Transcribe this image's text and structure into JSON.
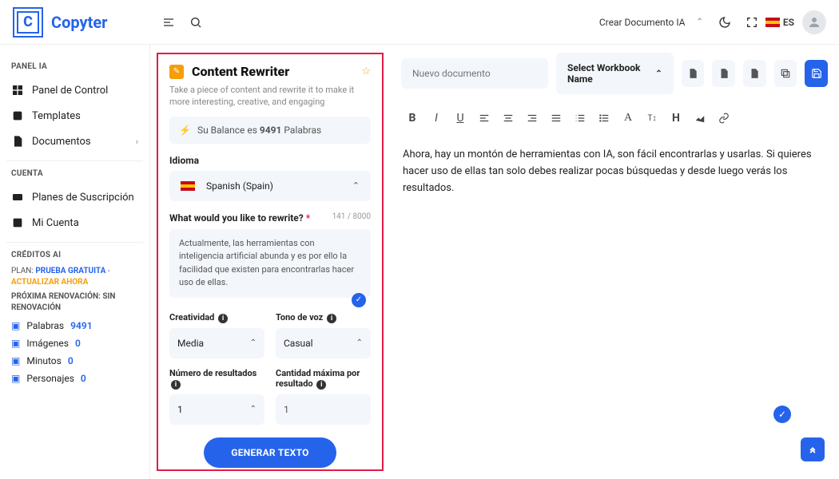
{
  "header": {
    "brand": "Copyter",
    "logo_letter": "C",
    "doc_ia": "Crear Documento IA",
    "lang_code": "ES"
  },
  "sidebar": {
    "section_panel": "PANEL IA",
    "panel_control": "Panel de Control",
    "templates": "Templates",
    "documentos": "Documentos",
    "section_cuenta": "CUENTA",
    "planes": "Planes de Suscripción",
    "mi_cuenta": "Mi Cuenta",
    "section_creditos": "CRÉDITOS AI",
    "plan_prefix": "PLAN: ",
    "plan_name": "PRUEBA GRATUITA",
    "plan_sep": " - ",
    "plan_action": "ACTUALIZAR AHORA",
    "renov": "PRÓXIMA RENOVACIÓN: SIN RENOVACIÓN",
    "stats": {
      "palabras_l": "Palabras",
      "palabras_v": "9491",
      "imagenes_l": "Imágenes",
      "imagenes_v": "0",
      "minutos_l": "Minutos",
      "minutos_v": "0",
      "personajes_l": "Personajes",
      "personajes_v": "0"
    }
  },
  "template": {
    "title": "Content Rewriter",
    "desc": "Take a piece of content and rewrite it to make it more interesting, creative, and engaging",
    "balance_pre": "Su Balance es ",
    "balance_num": "9491",
    "balance_post": " Palabras",
    "idioma_label": "Idioma",
    "idioma_value": "Spanish (Spain)",
    "rewrite_label": "What would you like to rewrite?",
    "rewrite_count": "141 / 8000",
    "rewrite_text": "Actualmente, las herramientas con inteligencia artificial abunda y es por ello la facilidad que existen para encontrarlas hacer uso de ellas.",
    "creatividad_label": "Creatividad",
    "creatividad_value": "Media",
    "tono_label": "Tono de voz",
    "tono_value": "Casual",
    "num_res_label": "Número de resultados",
    "num_res_value": "1",
    "max_label": "Cantidad máxima por resultado",
    "max_value": "1",
    "generate": "GENERAR TEXTO"
  },
  "editor": {
    "doc_placeholder": "Nuevo documento",
    "workbook": "Select Workbook Name",
    "body": "Ahora, hay un montón de herramientas con IA, son fácil encontrarlas y usarlas. Si quieres hacer uso de ellas tan solo debes realizar pocas búsquedas y desde luego verás los resultados."
  }
}
